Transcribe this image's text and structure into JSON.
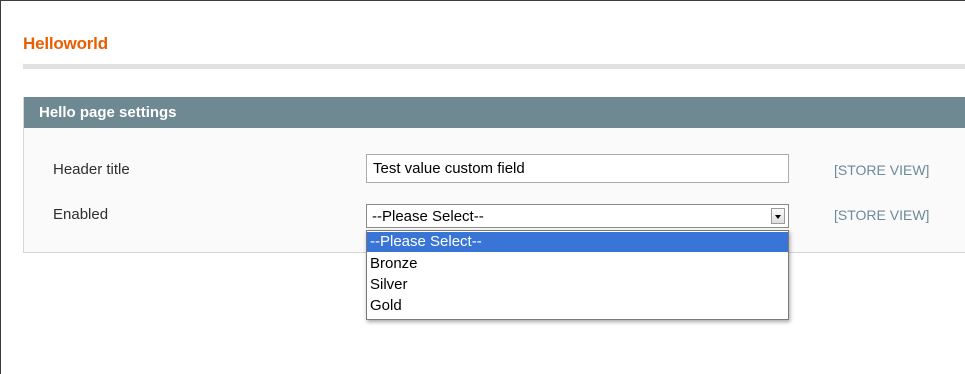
{
  "page": {
    "title": "Helloworld"
  },
  "fieldset": {
    "title": "Hello page settings",
    "fields": [
      {
        "label": "Header title",
        "value": "Test value custom field",
        "scope": "[STORE VIEW]"
      },
      {
        "label": "Enabled",
        "selected": "--Please Select--",
        "scope": "[STORE VIEW]",
        "options": [
          "--Please Select--",
          "Bronze",
          "Silver",
          "Gold"
        ]
      }
    ]
  },
  "colors": {
    "title": "#eb5e00",
    "fieldset_header": "#6f8992",
    "selected_option": "#3875d7",
    "scope_text": "#6b8a9a"
  }
}
